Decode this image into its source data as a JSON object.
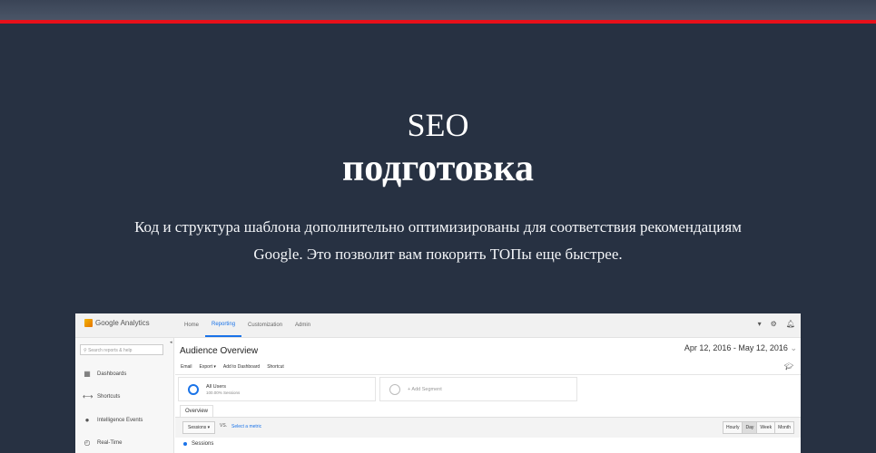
{
  "hero": {
    "title_light": "SEO",
    "title_bold": "подготовка",
    "description": "Код и структура шаблона дополнительно оптимизированы для соответствия рекомендациям Google. Это позволит вам покорить ТОПы еще быстрее."
  },
  "colors": {
    "background": "#273142",
    "accent_line": "#e8101a",
    "ga_blue": "#1a73e8"
  },
  "analytics": {
    "logo_text": "Google Analytics",
    "nav": [
      "Home",
      "Reporting",
      "Customization",
      "Admin"
    ],
    "active_nav": "Reporting",
    "search_placeholder": "Search reports & help",
    "sidebar": [
      {
        "label": "Dashboards",
        "icon": "grid-icon"
      },
      {
        "label": "Shortcuts",
        "icon": "arrows-icon"
      },
      {
        "label": "Intelligence Events",
        "icon": "bulb-icon"
      },
      {
        "label": "Real-Time",
        "icon": "clock-icon"
      }
    ],
    "page_title": "Audience Overview",
    "date_range": "Apr 12, 2016 - May 12, 2016",
    "actions": [
      "Email",
      "Export",
      "Add to Dashboard",
      "Shortcut"
    ],
    "segment_all": {
      "name": "All Users",
      "sub": "100.00% Sessions"
    },
    "segment_add": "+ Add Segment",
    "tab": "Overview",
    "metric": "Sessions",
    "vs": "VS.",
    "select_metric": "Select a metric",
    "granularity": [
      "Hourly",
      "Day",
      "Week",
      "Month"
    ],
    "selected_granularity": "Day",
    "series_label": "Sessions"
  }
}
